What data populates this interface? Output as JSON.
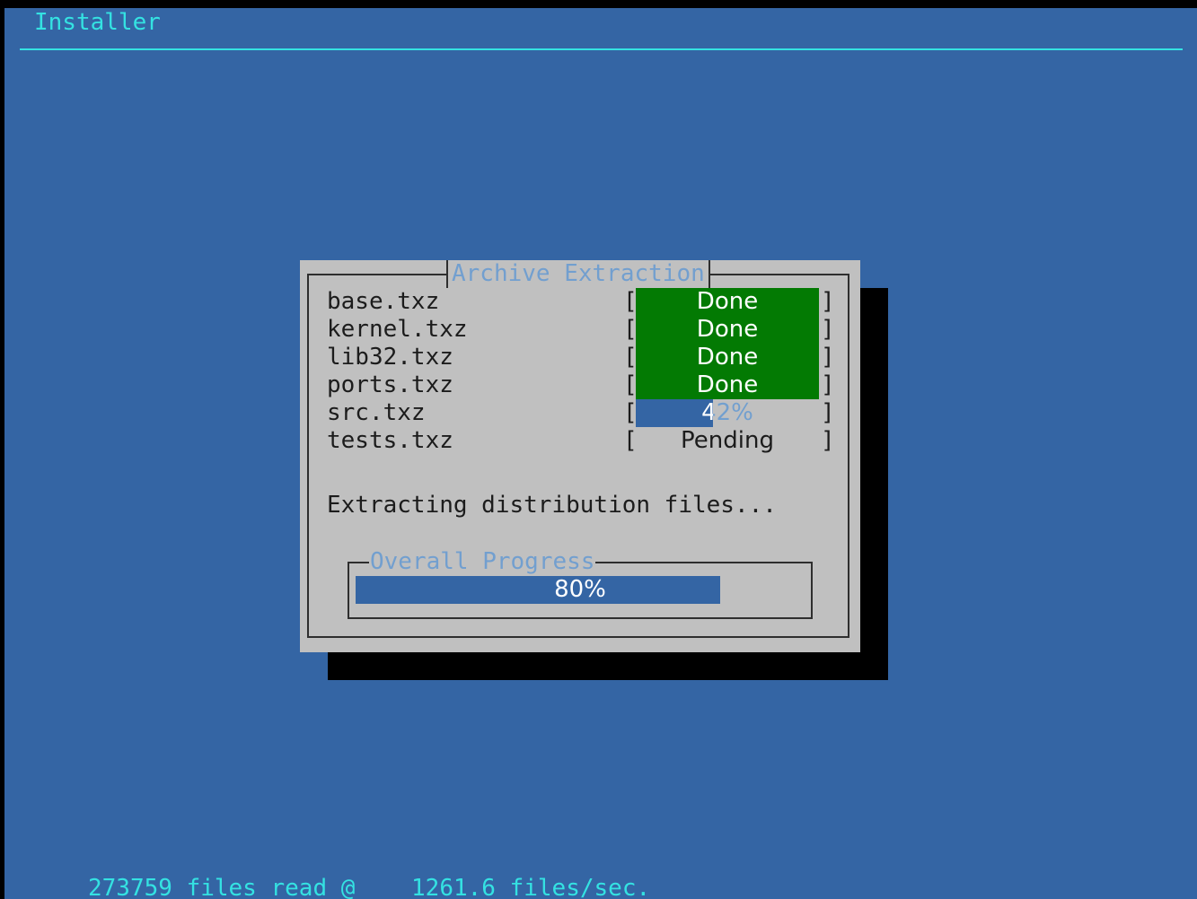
{
  "app": {
    "title": "Installer"
  },
  "dialog": {
    "title": "Archive Extraction",
    "items": [
      {
        "file": "base.txz",
        "status": "Done",
        "state": "done"
      },
      {
        "file": "kernel.txz",
        "status": "Done",
        "state": "done"
      },
      {
        "file": "lib32.txz",
        "status": "Done",
        "state": "done"
      },
      {
        "file": "ports.txz",
        "status": "Done",
        "state": "done"
      },
      {
        "file": "src.txz",
        "status": "42%",
        "state": "progress",
        "progress": 0.42
      },
      {
        "file": "tests.txz",
        "status": "Pending",
        "state": "pending"
      }
    ],
    "bracket_left": "[",
    "bracket_right": "]",
    "message": "Extracting distribution files...",
    "overall": {
      "title": "Overall Progress",
      "label": "80%",
      "progress": 0.8
    }
  },
  "footer": {
    "files_read": "273759",
    "rate": "1261.6",
    "text": "273759 files read @    1261.6 files/sec."
  },
  "colors": {
    "background": "#3465a4",
    "dialog": "#c0c0c0",
    "done": "#037a03",
    "accent_cyan": "#34e2e2",
    "title_blue": "#729fcf"
  }
}
